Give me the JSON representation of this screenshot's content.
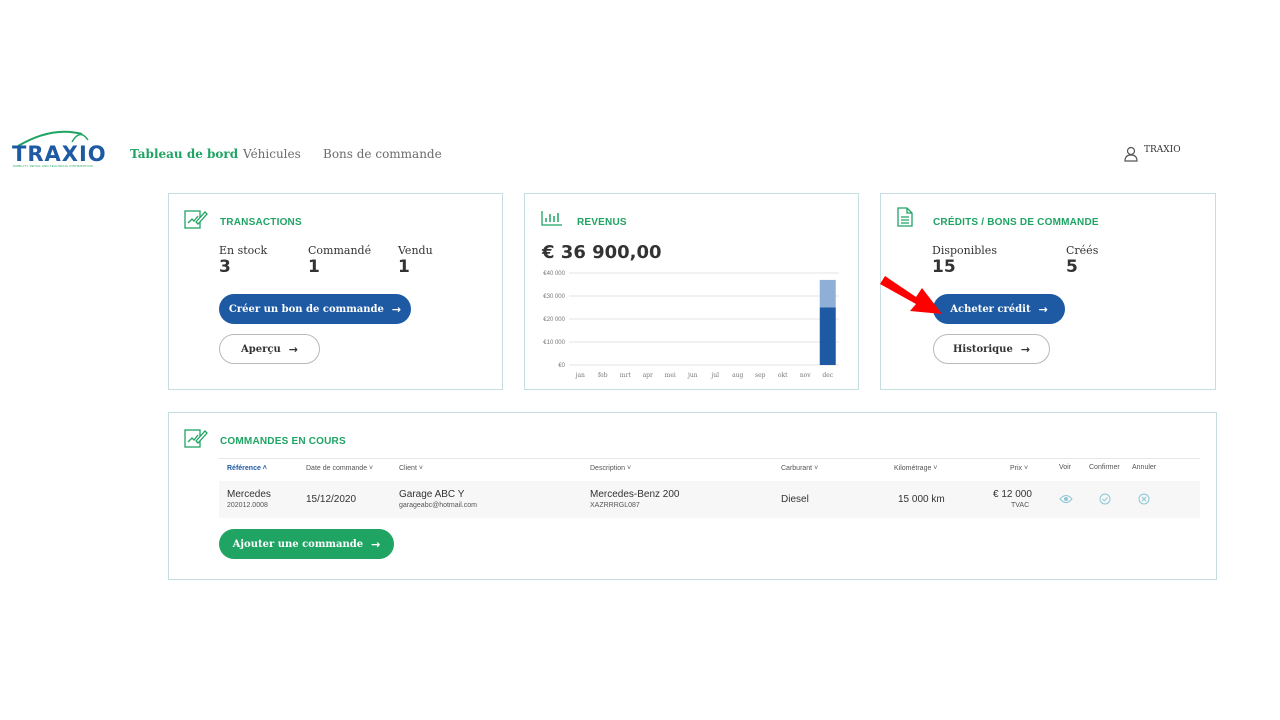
{
  "header": {
    "logo_text": "TRAXIO",
    "logo_tagline": "MOBILITY RETAIL AND TECHNICAL DISTRIBUTION",
    "nav": [
      {
        "label": "Tableau de bord",
        "active": true
      },
      {
        "label": "Véhicules",
        "active": false
      },
      {
        "label": "Bons de commande",
        "active": false
      }
    ],
    "user_name": "TRAXIO"
  },
  "transactions": {
    "title": "TRANSACTIONS",
    "stats": [
      {
        "label": "En stock",
        "value": "3"
      },
      {
        "label": "Commandé",
        "value": "1"
      },
      {
        "label": "Vendu",
        "value": "1"
      }
    ],
    "primary_button": "Créer un bon de commande",
    "secondary_button": "Aperçu"
  },
  "revenue": {
    "title": "REVENUS",
    "amount": "€ 36 900,00"
  },
  "credits": {
    "title": "CRÉDITS / BONS DE COMMANDE",
    "stats": [
      {
        "label": "Disponibles",
        "value": "15"
      },
      {
        "label": "Créés",
        "value": "5"
      }
    ],
    "primary_button": "Acheter crédit",
    "secondary_button": "Historique"
  },
  "orders": {
    "title": "COMMANDES EN COURS",
    "columns": {
      "reference": "Référence",
      "date": "Date de commande",
      "client": "Client",
      "description": "Description",
      "fuel": "Carburant",
      "mileage": "Kilométrage",
      "price": "Prix",
      "view": "Voir",
      "confirm": "Confirmer",
      "cancel": "Annuler"
    },
    "rows": [
      {
        "brand": "Mercedes",
        "reference": "202012.0008",
        "date": "15/12/2020",
        "client_name": "Garage ABC Y",
        "client_email": "garageabc@hotmail.com",
        "description": "Mercedes-Benz 200",
        "vin": "XAZRRRGL087",
        "fuel": "Diesel",
        "mileage": "15 000 km",
        "price": "€ 12 000",
        "price_note": "TVAC"
      }
    ],
    "add_button": "Ajouter une commande"
  },
  "colors": {
    "brand_blue": "#1e5aa3",
    "brand_green": "#1fa464",
    "bar_light": "#8eb0d8",
    "annotation_red": "#ff0000"
  },
  "chart_data": {
    "type": "bar",
    "title": "",
    "categories": [
      "jan",
      "feb",
      "mrt",
      "apr",
      "mei",
      "jun",
      "jul",
      "aug",
      "sep",
      "okt",
      "nov",
      "dec"
    ],
    "series": [
      {
        "values": [
          0,
          0,
          0,
          0,
          0,
          0,
          0,
          0,
          0,
          0,
          0,
          25000
        ]
      },
      {
        "values": [
          0,
          0,
          0,
          0,
          0,
          0,
          0,
          0,
          0,
          0,
          0,
          12000
        ]
      }
    ],
    "stacked": true,
    "ylim": [
      0,
      40000
    ],
    "yticks": [
      0,
      10000,
      20000,
      30000,
      40000
    ],
    "ytick_labels": [
      "€0",
      "€10 000",
      "€20 000",
      "€30 000",
      "€40 000"
    ],
    "grid": true
  }
}
